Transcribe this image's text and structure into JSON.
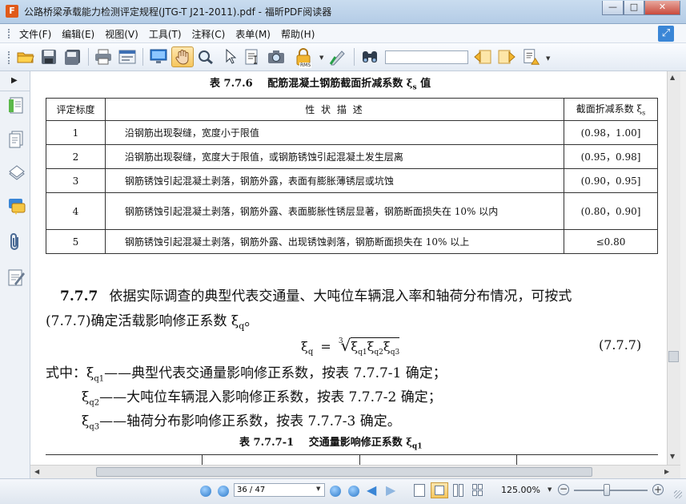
{
  "window": {
    "title": "公路桥梁承载能力检测评定规程(JTG-T J21-2011).pdf - 福昕PDF阅读器",
    "app_icon_label": "F",
    "minimize_glyph": "—",
    "maximize_glyph": "□",
    "close_glyph": "✕"
  },
  "menu": {
    "items": [
      "文件(F)",
      "编辑(E)",
      "视图(V)",
      "工具(T)",
      "注释(C)",
      "表单(M)",
      "帮助(H)"
    ],
    "restore_glyph": "⤢"
  },
  "toolbar": {
    "icons": [
      "open-icon",
      "save-icon",
      "save-as-icon",
      "print-icon",
      "properties-icon",
      "fullscreen-icon",
      "hand-tool-icon",
      "zoom-tool-icon",
      "select-arrow-icon",
      "text-select-icon",
      "snapshot-icon",
      "rms-lock-icon",
      "sign-icon",
      "find-binoculars-icon",
      "search-previous-icon",
      "search-next-icon",
      "search-options-icon"
    ],
    "rms_label": "RMS",
    "search_value": ""
  },
  "document": {
    "table_caption_prefix": "表 7.7.6",
    "table_caption_text": "配筋混凝土钢筋截面折减系数 ξ",
    "table_caption_sub": "s",
    "table_caption_suffix": " 值",
    "table_headers": [
      "评定标度",
      "性 状 描 述",
      "截面折减系数 ξ"
    ],
    "table_header_sub": "s",
    "table_rows": [
      {
        "grade": "1",
        "desc": "沿钢筋出现裂缝，宽度小于限值",
        "coef": "(0.98，1.00]"
      },
      {
        "grade": "2",
        "desc": "沿钢筋出现裂缝，宽度大于限值，或钢筋锈蚀引起混凝土发生层离",
        "coef": "(0.95，0.98]"
      },
      {
        "grade": "3",
        "desc": "钢筋锈蚀引起混凝土剥落，钢筋外露，表面有膨胀薄锈层或坑蚀",
        "coef": "(0.90，0.95]"
      },
      {
        "grade": "4",
        "desc": "钢筋锈蚀引起混凝土剥落，钢筋外露、表面膨胀性锈层显著，钢筋断面损失在 10% 以内",
        "coef": "(0.80，0.90]"
      },
      {
        "grade": "5",
        "desc": "钢筋锈蚀引起混凝土剥落，钢筋外露、出现锈蚀剥落，钢筋断面损失在 10% 以上",
        "coef": "≤0.80"
      }
    ],
    "para_number": "7.7.7",
    "para_line1": "依据实际调查的典型代表交通量、大吨位车辆混入率和轴荷分布情况，可按式",
    "para_line2_a": "(7.7.7)确定活载影响修正系数 ξ",
    "para_line2_sub": "q",
    "para_line2_b": "。",
    "formula_lhs": "ξ",
    "formula_lhs_sub": "q",
    "formula_eq": "=",
    "formula_root_index": "3",
    "formula_terms": [
      {
        "sym": "ξ",
        "sub": "q1"
      },
      {
        "sym": "ξ",
        "sub": "q2"
      },
      {
        "sym": "ξ",
        "sub": "q3"
      }
    ],
    "formula_number": "(7.7.7)",
    "where_prefix": "式中：",
    "definitions": [
      {
        "sym": "ξ",
        "sub": "q1",
        "text": "——典型代表交通量影响修正系数，按表 7.7.7-1 确定；"
      },
      {
        "sym": "ξ",
        "sub": "q2",
        "text": "——大吨位车辆混入影响修正系数，按表 7.7.7-2 确定；"
      },
      {
        "sym": "ξ",
        "sub": "q3",
        "text": "——轴荷分布影响修正系数，按表 7.7.7-3 确定。"
      }
    ],
    "next_caption_prefix": "表 7.7.7-1",
    "next_caption_text": "交通量影响修正系数 ξ",
    "next_caption_sub": "q1"
  },
  "statusbar": {
    "page_value": "36 / 47",
    "zoom_label": "125.00%",
    "zoom_slider_fraction": 0.45,
    "zoom_out_glyph": "−",
    "zoom_in_glyph": "+"
  },
  "colors": {
    "accent": "#3a86d6",
    "close_button": "#c94a3c"
  }
}
